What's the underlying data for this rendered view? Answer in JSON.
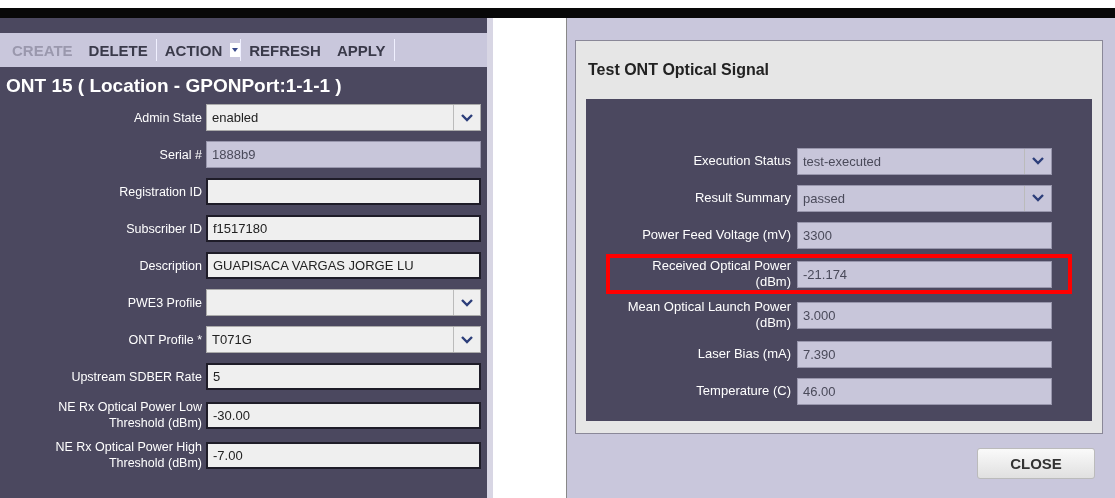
{
  "toolbar": {
    "buttons": [
      {
        "label": "CREATE",
        "disabled": true,
        "separator_after": false
      },
      {
        "label": "DELETE",
        "disabled": false,
        "separator_after": true
      },
      {
        "label": "ACTION",
        "disabled": false,
        "separator_after": true,
        "kind": "menu"
      },
      {
        "label": "REFRESH",
        "disabled": false,
        "separator_after": false
      },
      {
        "label": "APPLY",
        "disabled": false,
        "separator_after": true
      }
    ]
  },
  "panel": {
    "title": "ONT 15 ( Location - GPONPort:1-1-1 )",
    "fields": [
      {
        "label": "Admin State",
        "value": "enabled",
        "kind": "select",
        "disabled": false
      },
      {
        "label": "Serial #",
        "value": "1888b9",
        "kind": "text",
        "disabled": true
      },
      {
        "label": "Registration ID",
        "kind": "text",
        "disabled": false
      },
      {
        "label": "Subscriber ID",
        "value": "f1517180",
        "kind": "text",
        "disabled": false
      },
      {
        "label": "Description",
        "value": "GUAPISACA VARGAS JORGE LU",
        "kind": "text",
        "disabled": false
      },
      {
        "label": "PWE3 Profile",
        "kind": "select",
        "disabled": false
      },
      {
        "label": "ONT Profile *",
        "value": "T071G",
        "kind": "select",
        "disabled": false
      },
      {
        "label": "Upstream SDBER Rate",
        "value": "5",
        "kind": "text",
        "disabled": false
      },
      {
        "label": "NE Rx Optical Power Low Threshold (dBm)",
        "value": "-30.00",
        "kind": "text",
        "disabled": false
      },
      {
        "label": "NE Rx Optical Power High Threshold (dBm)",
        "value": "-7.00",
        "kind": "text",
        "disabled": false
      }
    ]
  },
  "dialog": {
    "title": "Test ONT Optical Signal",
    "fields": [
      {
        "label": "Execution Status",
        "value": "test-executed",
        "kind": "select",
        "disabled": true
      },
      {
        "label": "Result Summary",
        "value": "passed",
        "kind": "select",
        "disabled": true
      },
      {
        "label": "Power Feed Voltage (mV)",
        "value": "3300",
        "kind": "text",
        "disabled": true
      },
      {
        "label": "Received Optical Power (dBm)",
        "value": "-21.174",
        "kind": "text",
        "disabled": true,
        "highlighted": true
      },
      {
        "label": "Mean Optical Launch Power (dBm)",
        "value": "3.000",
        "kind": "text",
        "disabled": true
      },
      {
        "label": "Laser Bias (mA)",
        "value": "7.390",
        "kind": "text",
        "disabled": true
      },
      {
        "label": "Temperature (C)",
        "value": "46.00",
        "kind": "text",
        "disabled": true
      }
    ],
    "buttons": [
      "CLOSE"
    ]
  }
}
